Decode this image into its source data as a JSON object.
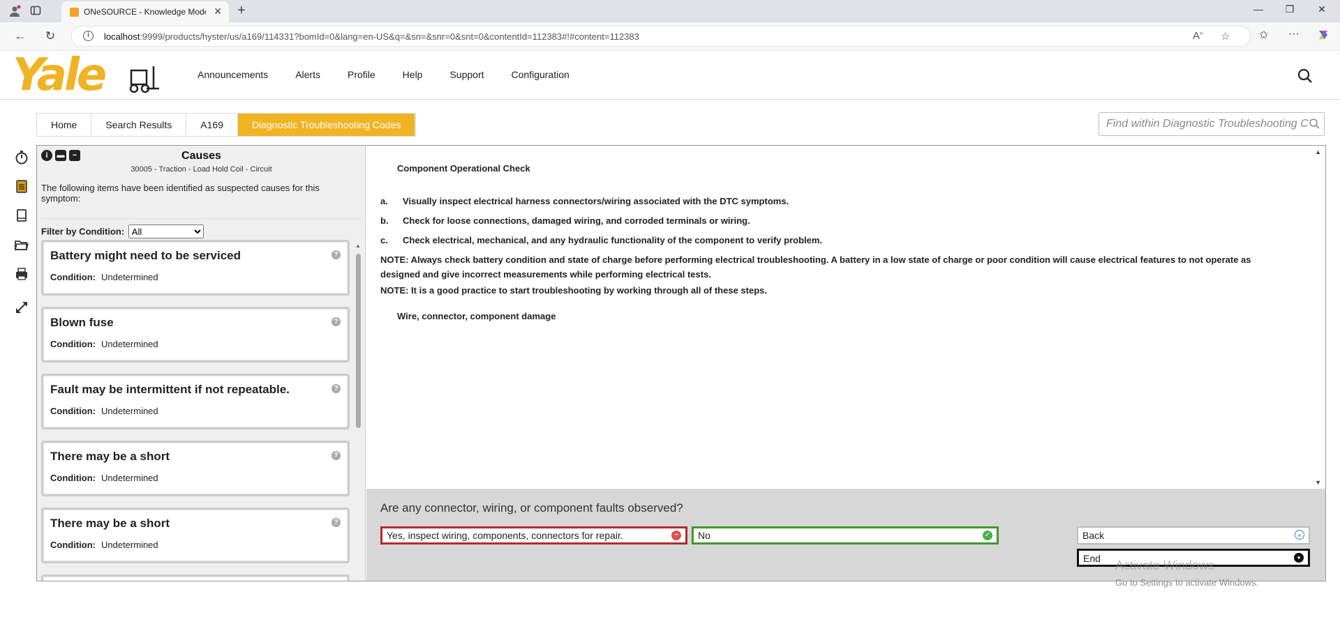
{
  "browser": {
    "tab_title": "ONeSOURCE - Knowledge Model",
    "url_host": "localhost",
    "url_rest": ":9999/products/hyster/us/a169/114331?bomId=0&lang=en-US&q=&sn=&snr=0&snt=0&contentId=112383#!#content=112383"
  },
  "site": {
    "logo_text": "Yale",
    "nav": [
      "Announcements",
      "Alerts",
      "Profile",
      "Help",
      "Support",
      "Configuration"
    ]
  },
  "breadcrumb": [
    "Home",
    "Search Results",
    "A169",
    "Diagnostic Troubleshooting Codes"
  ],
  "find": {
    "placeholder": "Find within Diagnostic Troubleshooting Codes"
  },
  "causes": {
    "title": "Causes",
    "subtitle": "30005 - Traction - Load Hold Coil - Circuit",
    "description": "The following items have been identified as suspected causes for this symptom:",
    "filter_label": "Filter by Condition:",
    "filter_value": "All",
    "condition_label": "Condition:",
    "items": [
      {
        "title": "Battery might need to be serviced",
        "condition": "Undetermined"
      },
      {
        "title": "Blown fuse",
        "condition": "Undetermined"
      },
      {
        "title": "Fault may be intermittent if not repeatable.",
        "condition": "Undetermined"
      },
      {
        "title": "There may be a short",
        "condition": "Undetermined"
      },
      {
        "title": "There may be a short",
        "condition": "Undetermined"
      }
    ]
  },
  "content": {
    "heading": "Component Operational Check",
    "steps": [
      {
        "label": "a.",
        "text": "Visually inspect electrical harness connectors/wiring associated with the DTC symptoms."
      },
      {
        "label": "b.",
        "text": "Check for loose connections, damaged wiring, and corroded terminals or wiring."
      },
      {
        "label": "c.",
        "text": "Check electrical, mechanical, and any hydraulic functionality of the component to verify problem."
      }
    ],
    "note1": "NOTE: Always check battery condition and state of charge before performing electrical troubleshooting. A battery in a low state of charge or poor condition will cause electrical features to not operate as designed and give incorrect measurements while performing electrical tests.",
    "note2": "NOTE: It is a good practice to start troubleshooting by working through all of these steps.",
    "subheading": "Wire, connector, component damage"
  },
  "question": {
    "text": "Are any connector, wiring, or component faults observed?",
    "yes": "Yes, inspect wiring, components, connectors for repair.",
    "no": "No",
    "back": "Back",
    "end": "End"
  },
  "watermark": {
    "title": "Activate Windows",
    "text": "Go to Settings to activate Windows."
  },
  "colors": {
    "accent": "#f0b323",
    "yes_border": "#b32b2b",
    "no_border": "#3f9a2a"
  }
}
